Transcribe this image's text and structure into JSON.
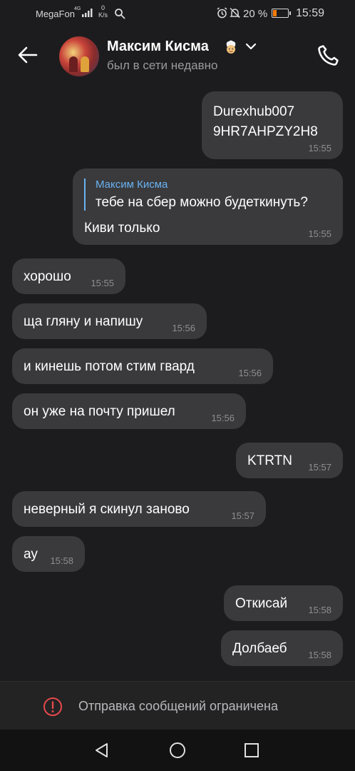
{
  "status_bar": {
    "carrier": "MegaFon",
    "network": "4G",
    "speed_value": "0",
    "speed_unit": "K/s",
    "battery_percent": "20 %",
    "time": "15:59",
    "icons": [
      "signal-icon",
      "search-icon",
      "alarm-icon",
      "mute-icon",
      "battery-icon"
    ],
    "battery_color": "#ff7a00"
  },
  "header": {
    "contact_name": "Максим Кисма",
    "name_emoji": "👨‍🍳",
    "status": "был в сети недавно",
    "icons": [
      "back-arrow-icon",
      "chevron-down-icon",
      "phone-icon"
    ]
  },
  "messages": [
    {
      "direction": "outgoing",
      "lines": [
        "Durexhub007",
        "9HR7AHPZY2H8"
      ],
      "time": "15:55"
    },
    {
      "direction": "outgoing",
      "reply_to": {
        "author": "Максим Кисма",
        "text": "тебе на сбер можно будеткинуть?"
      },
      "text": "Киви только",
      "time": "15:55"
    },
    {
      "direction": "incoming",
      "text": "хорошо",
      "time": "15:55"
    },
    {
      "direction": "incoming",
      "text": "ща гляну и напишу",
      "time": "15:56"
    },
    {
      "direction": "incoming",
      "text": "и кинешь потом стим гвард",
      "time": "15:56"
    },
    {
      "direction": "incoming",
      "text": "он уже на почту пришел",
      "time": "15:56"
    },
    {
      "direction": "outgoing",
      "text": "KTRTN",
      "time": "15:57"
    },
    {
      "direction": "incoming",
      "text": "неверный я скинул заново",
      "time": "15:57"
    },
    {
      "direction": "incoming",
      "text": "ау",
      "time": "15:58"
    },
    {
      "direction": "outgoing",
      "text": "Откисай",
      "time": "15:58"
    },
    {
      "direction": "outgoing",
      "text": "Долбаеб",
      "time": "15:58"
    }
  ],
  "restriction": {
    "text": "Отправка сообщений ограничена",
    "icon": "error-icon",
    "icon_color": "#e5484d"
  },
  "navigation_bar": {
    "icons": [
      "nav-back-icon",
      "nav-home-icon",
      "nav-recents-icon"
    ]
  },
  "colors": {
    "background": "#1c1c1e",
    "bubble": "#3a3a3c",
    "reply_accent": "#6ab2f2",
    "timestamp": "#8e8e93"
  }
}
